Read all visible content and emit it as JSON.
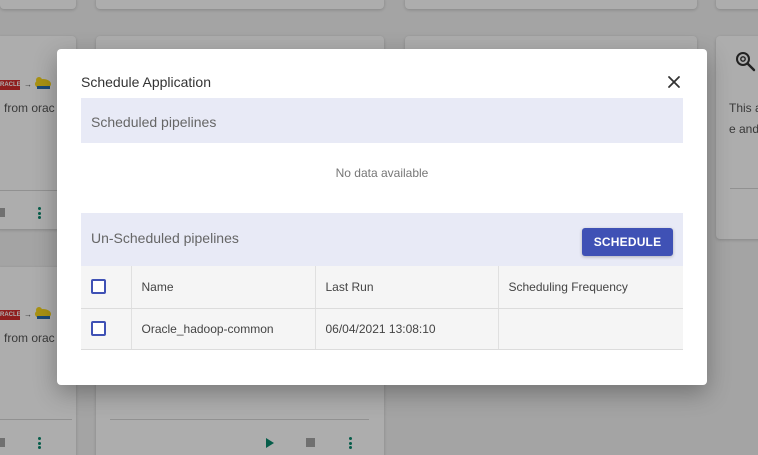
{
  "background": {
    "cards": [
      {
        "line1": "from orac",
        "line2": ""
      },
      {
        "line1": "from orac",
        "line2": ""
      }
    ],
    "right_card": {
      "line1": "This a",
      "line2": "e and"
    }
  },
  "dialog": {
    "title": "Schedule Application",
    "scheduled_section_title": "Scheduled pipelines",
    "scheduled_empty_text": "No data available",
    "unscheduled_section_title": "Un-Scheduled pipelines",
    "schedule_button_label": "SCHEDULE",
    "columns": [
      "Name",
      "Last Run",
      "Scheduling Frequency"
    ],
    "rows": [
      {
        "name": "Oracle_hadoop-common",
        "last_run": "06/04/2021 13:08:10",
        "frequency": ""
      }
    ]
  },
  "colors": {
    "primary": "#3f51b5",
    "section_header_bg": "#e8eaf6",
    "action_green": "#0a8a6e",
    "oracle_red": "#d32f2f"
  },
  "icons": {
    "close": "close-icon",
    "play": "play-icon",
    "stop": "stop-icon",
    "more": "more-vert-icon",
    "search_settings": "search-settings-icon"
  }
}
